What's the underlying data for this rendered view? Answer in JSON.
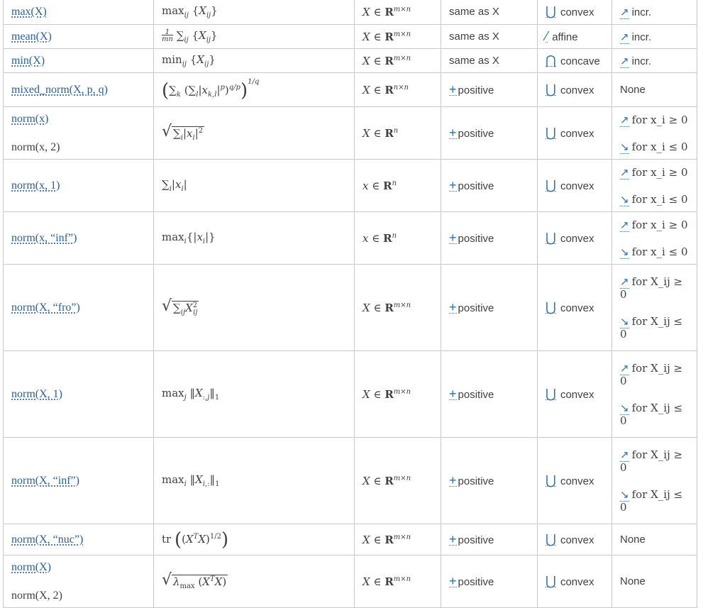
{
  "rows": [
    {
      "fn": [
        "max(X)"
      ],
      "meaning": "max_ij {X_ij}",
      "domain": "X ∈ R^{m×n}",
      "sign": "same as X",
      "curv": "convex",
      "mono": [
        "incr."
      ]
    },
    {
      "fn": [
        "mean(X)"
      ],
      "meaning": "1/mn ∑_ij {X_ij}",
      "domain": "X ∈ R^{m×n}",
      "sign": "same as X",
      "curv": "affine",
      "mono": [
        "incr."
      ]
    },
    {
      "fn": [
        "min(X)"
      ],
      "meaning": "min_ij {X_ij}",
      "domain": "X ∈ R^{m×n}",
      "sign": "same as X",
      "curv": "concave",
      "mono": [
        "incr."
      ]
    },
    {
      "fn": [
        "mixed_norm(X, p, q)"
      ],
      "meaning": "(∑_k (∑_l |x_{k,l}|^p)^{q/p})^{1/q}",
      "domain": "X ∈ R^{n×n}",
      "sign": "positive",
      "curv": "convex",
      "mono": [
        "None"
      ]
    },
    {
      "fn": [
        "norm(x)",
        "norm(x, 2)"
      ],
      "meaning": "√(∑_i |x_i|^2)",
      "domain": "X ∈ R^n",
      "sign": "positive",
      "curv": "convex",
      "mono": [
        "for x_i ≥ 0",
        "for x_i ≤ 0"
      ]
    },
    {
      "fn": [
        "norm(x, 1)"
      ],
      "meaning": "∑_i |x_i|",
      "domain": "x ∈ R^n",
      "sign": "positive",
      "curv": "convex",
      "mono": [
        "for x_i ≥ 0",
        "for x_i ≤ 0"
      ]
    },
    {
      "fn": [
        "norm(x, “inf”)"
      ],
      "meaning": "max_i {|x_i|}",
      "domain": "x ∈ R^n",
      "sign": "positive",
      "curv": "convex",
      "mono": [
        "for x_i ≥ 0",
        "for x_i ≤ 0"
      ]
    },
    {
      "fn": [
        "norm(X, “fro”)"
      ],
      "meaning": "√(∑_ij X_ij^2)",
      "domain": "X ∈ R^{m×n}",
      "sign": "positive",
      "curv": "convex",
      "mono": [
        "for X_ij ≥ 0",
        "for X_ij ≤ 0"
      ]
    },
    {
      "fn": [
        "norm(X, 1)"
      ],
      "meaning": "max_j ‖X_{:,j}‖_1",
      "domain": "X ∈ R^{m×n}",
      "sign": "positive",
      "curv": "convex",
      "mono": [
        "for X_ij ≥ 0",
        "for X_ij ≤ 0"
      ]
    },
    {
      "fn": [
        "norm(X, “inf”)"
      ],
      "meaning": "max_i ‖X_{i,:}‖_1",
      "domain": "X ∈ R^{m×n}",
      "sign": "positive",
      "curv": "convex",
      "mono": [
        "for X_ij ≥ 0",
        "for X_ij ≤ 0"
      ]
    },
    {
      "fn": [
        "norm(X, “nuc”)"
      ],
      "meaning": "tr((X^T X)^{1/2})",
      "domain": "X ∈ R^{m×n}",
      "sign": "positive",
      "curv": "convex",
      "mono": [
        "None"
      ]
    },
    {
      "fn": [
        "norm(X)",
        "norm(X, 2)"
      ],
      "meaning": "√(λ_max (X^T X))",
      "domain": "X ∈ R^{m×n}",
      "sign": "positive",
      "curv": "convex",
      "mono": [
        "None"
      ]
    }
  ],
  "icons": {
    "convex": "cup-icon",
    "concave": "cap-icon",
    "affine": "line-icon",
    "positive": "plus-icon",
    "incr": "arrow-up-right-icon",
    "decr": "arrow-down-right-icon"
  },
  "colors": {
    "link": "#2b5f96",
    "icon": "#2b6fad",
    "border": "#c9c9c9",
    "text": "#404040"
  }
}
